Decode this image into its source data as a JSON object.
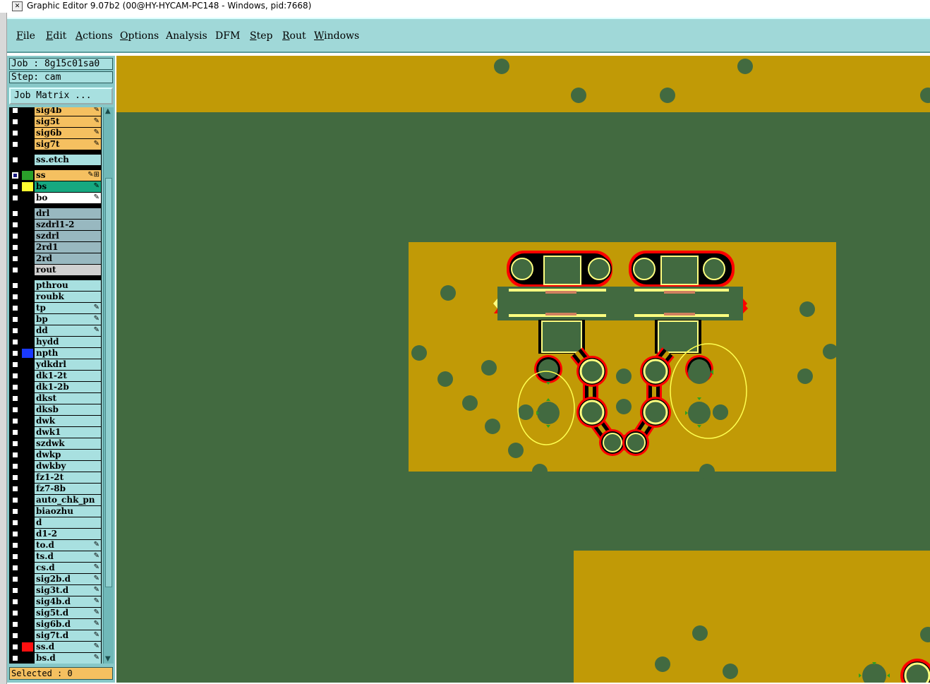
{
  "window": {
    "title": "Graphic Editor 9.07b2 (00@HY-HYCAM-PC148 - Windows, pid:7668)"
  },
  "menu": [
    {
      "label": "File",
      "ul": "F"
    },
    {
      "label": "Edit",
      "ul": "E"
    },
    {
      "label": "Actions",
      "ul": "A"
    },
    {
      "label": "Options",
      "ul": "O"
    },
    {
      "label": "Analysis",
      "ul": ""
    },
    {
      "label": "DFM",
      "ul": ""
    },
    {
      "label": "Step",
      "ul": "S"
    },
    {
      "label": "Rout",
      "ul": "R"
    },
    {
      "label": "Windows",
      "ul": "W"
    }
  ],
  "job": {
    "label": "Job : 8g15c01sa0"
  },
  "step": {
    "label": "Step: cam"
  },
  "job_matrix_button": "Job Matrix ...",
  "status": {
    "selected": "Selected : 0"
  },
  "colors": {
    "copper": "#c19a06",
    "board": "#426a40",
    "pad_fill": "#426a40",
    "outline": "#ffff80",
    "drc_red": "#ff0000"
  },
  "layers": [
    {
      "name": "sig4b",
      "color": "#f5c060",
      "swatch": "#000000",
      "icon": "✎"
    },
    {
      "name": "sig5t",
      "color": "#f5c060",
      "swatch": "#000000",
      "icon": "✎"
    },
    {
      "name": "sig6b",
      "color": "#f5c060",
      "swatch": "#000000",
      "icon": "✎"
    },
    {
      "name": "sig7t",
      "color": "#f5c060",
      "swatch": "#000000",
      "icon": "✎"
    },
    {
      "name": "ss.etch",
      "color": "#a8e0e0",
      "swatch": "#000000",
      "icon": ""
    },
    {
      "name": "ss",
      "color": "#f5c060",
      "swatch": "#2aa02a",
      "icon": "✎⊞",
      "checked": true
    },
    {
      "name": "bs",
      "color": "#16a880",
      "swatch": "#ffff30",
      "icon": "✎"
    },
    {
      "name": "bo",
      "color": "#ffffff",
      "swatch": "#000000",
      "icon": "✎"
    },
    {
      "name": "drl",
      "color": "#98b8c0",
      "swatch": "#000000",
      "icon": ""
    },
    {
      "name": "szdrl1-2",
      "color": "#98b8c0",
      "swatch": "#000000",
      "icon": ""
    },
    {
      "name": "szdrl",
      "color": "#98b8c0",
      "swatch": "#000000",
      "icon": ""
    },
    {
      "name": "2rd1",
      "color": "#98b8c0",
      "swatch": "#000000",
      "icon": ""
    },
    {
      "name": "2rd",
      "color": "#98b8c0",
      "swatch": "#000000",
      "icon": ""
    },
    {
      "name": "rout",
      "color": "#d0d0d0",
      "swatch": "#000000",
      "icon": ""
    },
    {
      "name": "pthrou",
      "color": "#a8e0e0",
      "swatch": "#000000",
      "icon": ""
    },
    {
      "name": "roubk",
      "color": "#a8e0e0",
      "swatch": "#000000",
      "icon": ""
    },
    {
      "name": "tp",
      "color": "#a8e0e0",
      "swatch": "#000000",
      "icon": "✎"
    },
    {
      "name": "bp",
      "color": "#a8e0e0",
      "swatch": "#000000",
      "icon": "✎"
    },
    {
      "name": "dd",
      "color": "#a8e0e0",
      "swatch": "#000000",
      "icon": "✎"
    },
    {
      "name": "hydd",
      "color": "#a8e0e0",
      "swatch": "#000000",
      "icon": ""
    },
    {
      "name": "npth",
      "color": "#a8e0e0",
      "swatch": "#1a3aff",
      "icon": ""
    },
    {
      "name": "ydkdrl",
      "color": "#a8e0e0",
      "swatch": "#000000",
      "icon": ""
    },
    {
      "name": "dk1-2t",
      "color": "#a8e0e0",
      "swatch": "#000000",
      "icon": ""
    },
    {
      "name": "dk1-2b",
      "color": "#a8e0e0",
      "swatch": "#000000",
      "icon": ""
    },
    {
      "name": "dkst",
      "color": "#a8e0e0",
      "swatch": "#000000",
      "icon": ""
    },
    {
      "name": "dksb",
      "color": "#a8e0e0",
      "swatch": "#000000",
      "icon": ""
    },
    {
      "name": "dwk",
      "color": "#a8e0e0",
      "swatch": "#000000",
      "icon": ""
    },
    {
      "name": "dwk1",
      "color": "#a8e0e0",
      "swatch": "#000000",
      "icon": ""
    },
    {
      "name": "szdwk",
      "color": "#a8e0e0",
      "swatch": "#000000",
      "icon": ""
    },
    {
      "name": "dwkp",
      "color": "#a8e0e0",
      "swatch": "#000000",
      "icon": ""
    },
    {
      "name": "dwkby",
      "color": "#a8e0e0",
      "swatch": "#000000",
      "icon": ""
    },
    {
      "name": "fz1-2t",
      "color": "#a8e0e0",
      "swatch": "#000000",
      "icon": ""
    },
    {
      "name": "fz7-8b",
      "color": "#a8e0e0",
      "swatch": "#000000",
      "icon": ""
    },
    {
      "name": "auto_chk_pn",
      "color": "#a8e0e0",
      "swatch": "#000000",
      "icon": ""
    },
    {
      "name": "biaozhu",
      "color": "#a8e0e0",
      "swatch": "#000000",
      "icon": ""
    },
    {
      "name": "d",
      "color": "#a8e0e0",
      "swatch": "#000000",
      "icon": ""
    },
    {
      "name": "d1-2",
      "color": "#a8e0e0",
      "swatch": "#000000",
      "icon": ""
    },
    {
      "name": "to.d",
      "color": "#a8e0e0",
      "swatch": "#000000",
      "icon": "✎"
    },
    {
      "name": "ts.d",
      "color": "#a8e0e0",
      "swatch": "#000000",
      "icon": "✎"
    },
    {
      "name": "cs.d",
      "color": "#a8e0e0",
      "swatch": "#000000",
      "icon": "✎"
    },
    {
      "name": "sig2b.d",
      "color": "#a8e0e0",
      "swatch": "#000000",
      "icon": "✎"
    },
    {
      "name": "sig3t.d",
      "color": "#a8e0e0",
      "swatch": "#000000",
      "icon": "✎"
    },
    {
      "name": "sig4b.d",
      "color": "#a8e0e0",
      "swatch": "#000000",
      "icon": "✎"
    },
    {
      "name": "sig5t.d",
      "color": "#a8e0e0",
      "swatch": "#000000",
      "icon": "✎"
    },
    {
      "name": "sig6b.d",
      "color": "#a8e0e0",
      "swatch": "#000000",
      "icon": "✎"
    },
    {
      "name": "sig7t.d",
      "color": "#a8e0e0",
      "swatch": "#000000",
      "icon": "✎"
    },
    {
      "name": "ss.d",
      "color": "#a8e0e0",
      "swatch": "#ff1010",
      "icon": "✎"
    },
    {
      "name": "bs.d",
      "color": "#a8e0e0",
      "swatch": "#000000",
      "icon": "✎"
    }
  ]
}
